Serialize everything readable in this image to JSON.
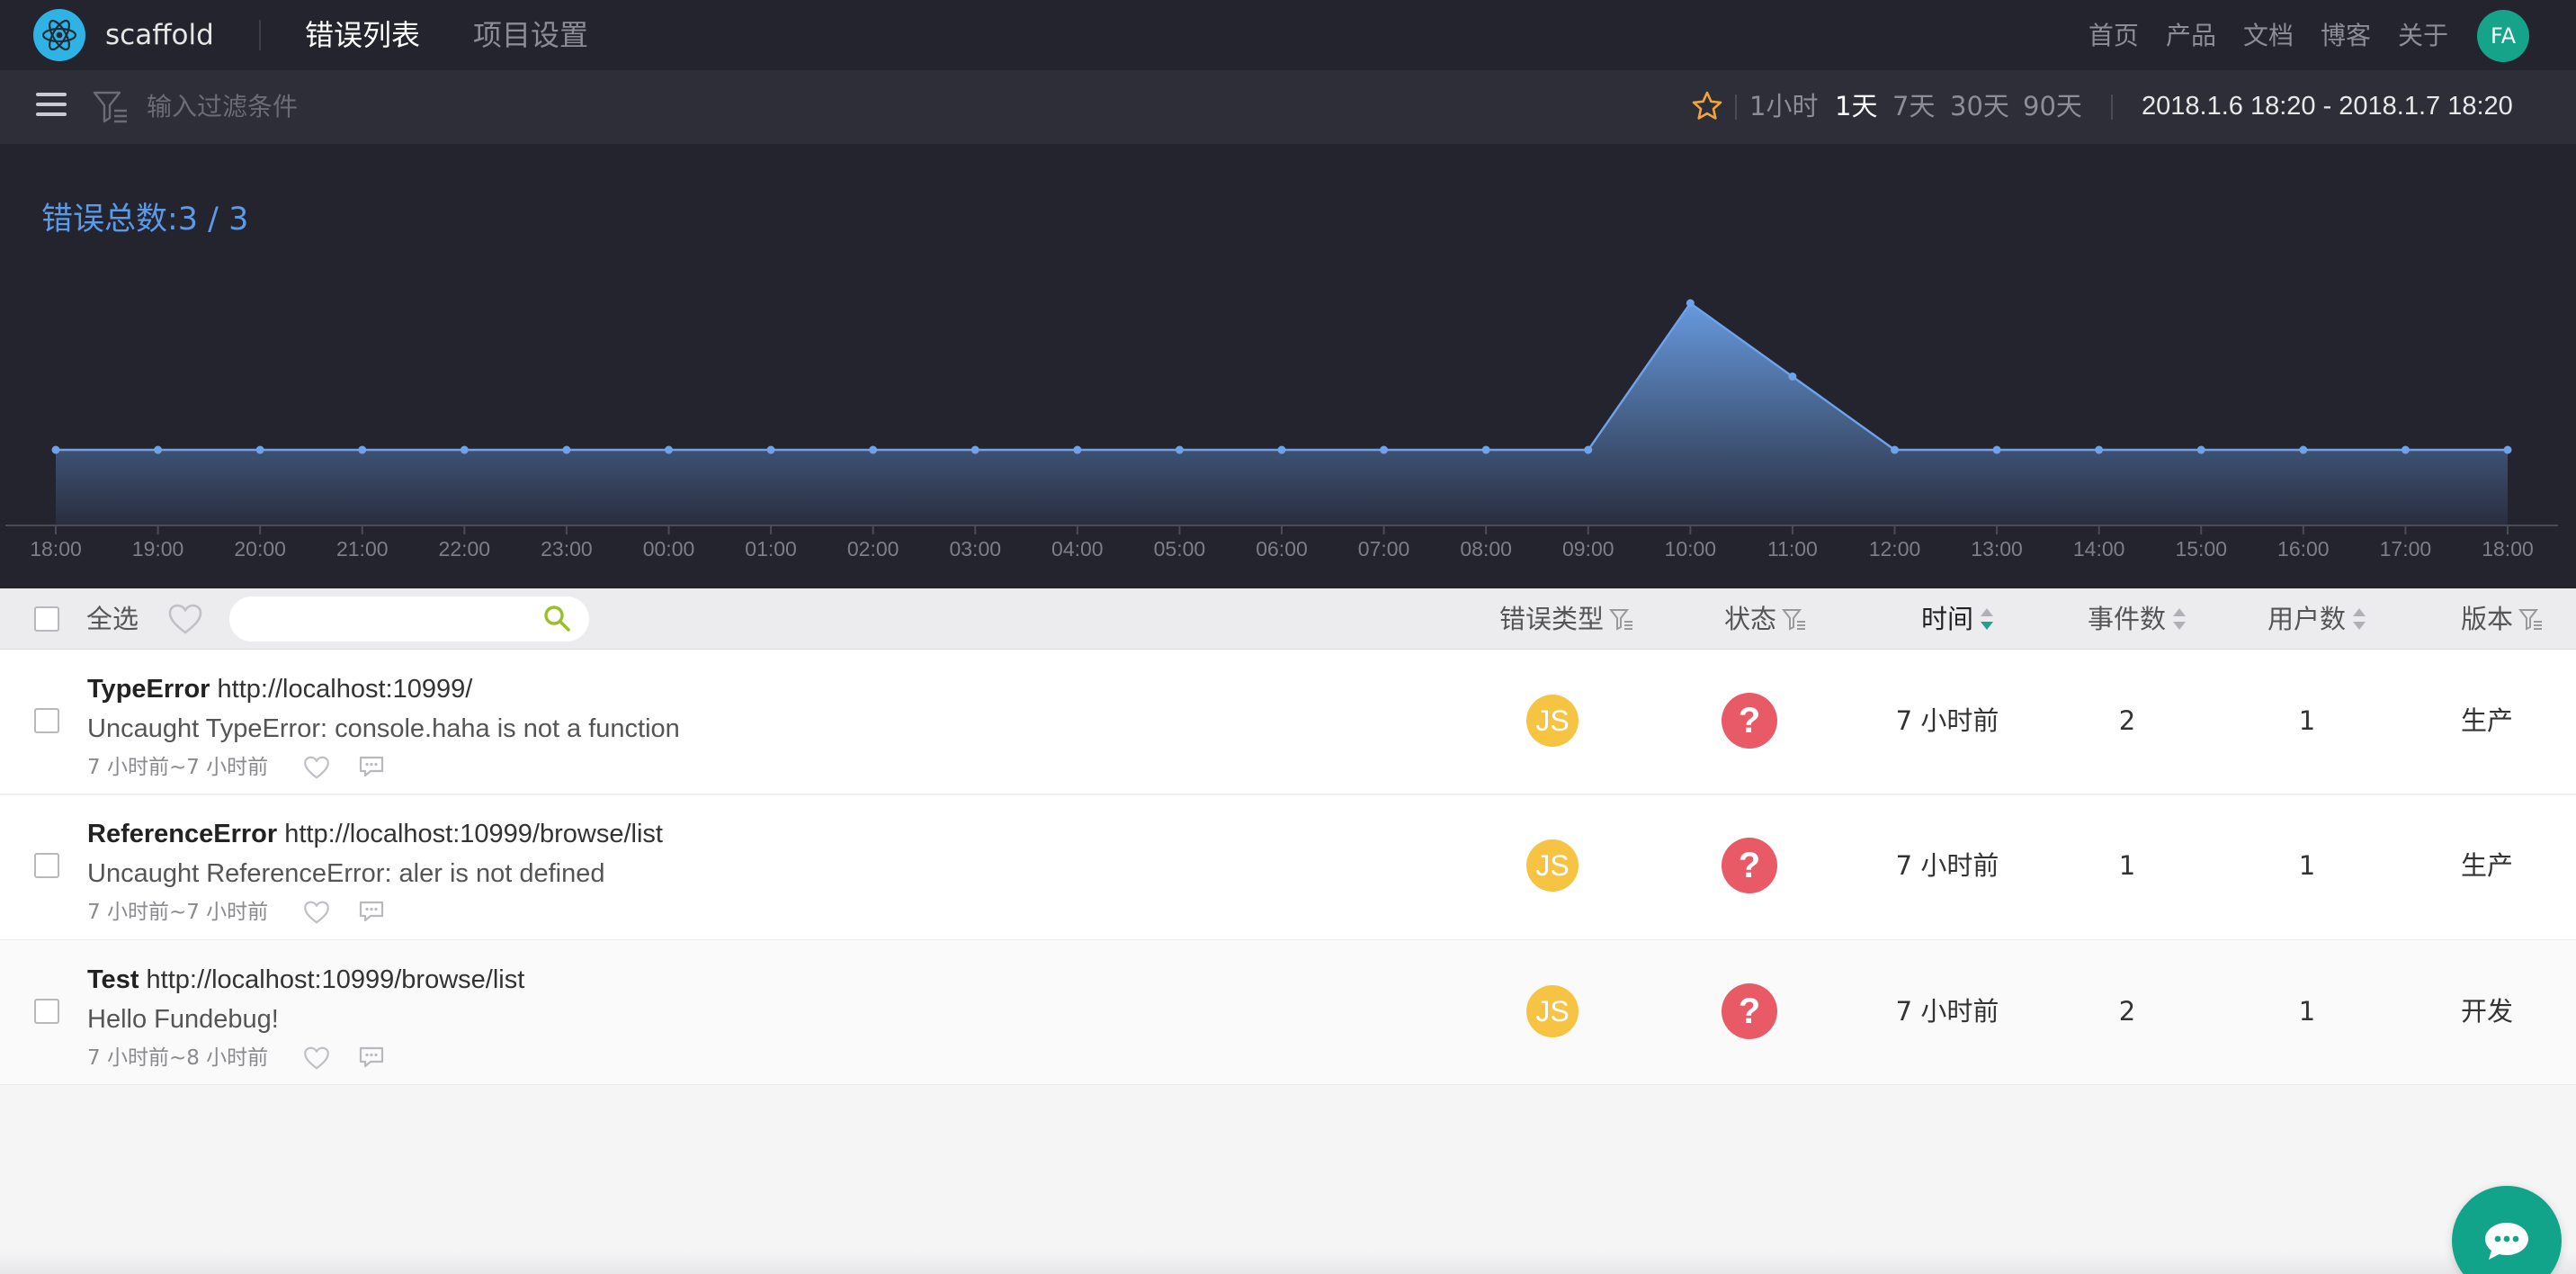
{
  "app": {
    "name": "scaffold",
    "tabs": [
      {
        "label": "错误列表",
        "active": true
      },
      {
        "label": "项目设置",
        "active": false
      }
    ],
    "links": [
      "首页",
      "产品",
      "文档",
      "博客",
      "关于"
    ],
    "user_initials": "FA"
  },
  "filter": {
    "placeholder": "输入过滤条件",
    "ranges": [
      {
        "label": "1小时",
        "active": false
      },
      {
        "label": "1天",
        "active": true
      },
      {
        "label": "7天",
        "active": false
      },
      {
        "label": "30天",
        "active": false
      },
      {
        "label": "90天",
        "active": false
      }
    ],
    "date_range": "2018.1.6 18:20 - 2018.1.7 18:20"
  },
  "chart": {
    "title": "错误总数:3 / 3"
  },
  "chart_data": {
    "type": "area",
    "title": "错误总数:3 / 3",
    "x": [
      "18:00",
      "19:00",
      "20:00",
      "21:00",
      "22:00",
      "23:00",
      "00:00",
      "01:00",
      "02:00",
      "03:00",
      "04:00",
      "05:00",
      "06:00",
      "07:00",
      "08:00",
      "09:00",
      "10:00",
      "11:00",
      "12:00",
      "13:00",
      "14:00",
      "15:00",
      "16:00",
      "17:00",
      "18:00"
    ],
    "series": [
      {
        "values": [
          0,
          0,
          0,
          0,
          0,
          0,
          0,
          0,
          0,
          0,
          0,
          0,
          0,
          0,
          0,
          0,
          2,
          1,
          0,
          0,
          0,
          0,
          0,
          0,
          0
        ]
      }
    ],
    "xlabel": "",
    "ylabel": "",
    "ylim": [
      0,
      2
    ],
    "grid": false,
    "colors": {
      "line": "#6ea3ec",
      "fill_top": "#5b8fd6",
      "fill_bottom": "#2a2f40"
    }
  },
  "list": {
    "select_all": "全选",
    "search_placeholder": "",
    "columns": {
      "type": "错误类型",
      "status": "状态",
      "time": "时间",
      "events": "事件数",
      "users": "用户数",
      "version": "版本"
    },
    "rows": [
      {
        "name": "TypeError",
        "url": "http://localhost:10999/",
        "message": "Uncaught TypeError: console.haha is not a function",
        "range": "7 小时前~7 小时前",
        "badge": "JS",
        "status_glyph": "?",
        "time": "7 小时前",
        "events": "2",
        "users": "1",
        "version": "生产"
      },
      {
        "name": "ReferenceError",
        "url": "http://localhost:10999/browse/list",
        "message": "Uncaught ReferenceError: aler is not defined",
        "range": "7 小时前~7 小时前",
        "badge": "JS",
        "status_glyph": "?",
        "time": "7 小时前",
        "events": "1",
        "users": "1",
        "version": "生产"
      },
      {
        "name": "Test",
        "url": "http://localhost:10999/browse/list",
        "message": "Hello Fundebug!",
        "range": "7 小时前~8 小时前",
        "badge": "JS",
        "status_glyph": "?",
        "time": "7 小时前",
        "events": "2",
        "users": "1",
        "version": "开发"
      }
    ]
  }
}
